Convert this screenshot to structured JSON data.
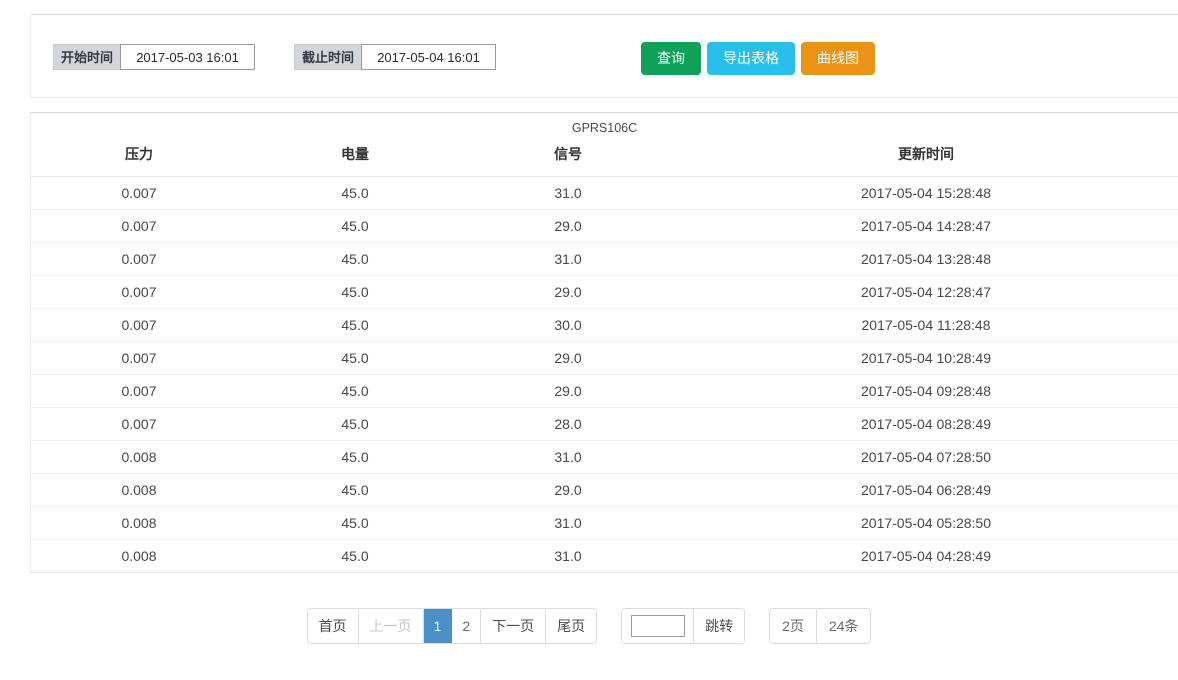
{
  "filters": {
    "start_label": "开始时间",
    "start_value": "2017-05-03 16:01",
    "end_label": "截止时间",
    "end_value": "2017-05-04 16:01",
    "buttons": {
      "query": "查询",
      "export": "导出表格",
      "chart": "曲线图"
    },
    "colors": {
      "query": "#0fa158",
      "export": "#28c0ea",
      "chart": "#eb9316"
    }
  },
  "table": {
    "caption": "GPRS106C",
    "columns": [
      "压力",
      "电量",
      "信号",
      "更新时间"
    ],
    "rows": [
      [
        "0.007",
        "45.0",
        "31.0",
        "2017-05-04 15:28:48"
      ],
      [
        "0.007",
        "45.0",
        "29.0",
        "2017-05-04 14:28:47"
      ],
      [
        "0.007",
        "45.0",
        "31.0",
        "2017-05-04 13:28:48"
      ],
      [
        "0.007",
        "45.0",
        "29.0",
        "2017-05-04 12:28:47"
      ],
      [
        "0.007",
        "45.0",
        "30.0",
        "2017-05-04 11:28:48"
      ],
      [
        "0.007",
        "45.0",
        "29.0",
        "2017-05-04 10:28:49"
      ],
      [
        "0.007",
        "45.0",
        "29.0",
        "2017-05-04 09:28:48"
      ],
      [
        "0.007",
        "45.0",
        "28.0",
        "2017-05-04 08:28:49"
      ],
      [
        "0.008",
        "45.0",
        "31.0",
        "2017-05-04 07:28:50"
      ],
      [
        "0.008",
        "45.0",
        "29.0",
        "2017-05-04 06:28:49"
      ],
      [
        "0.008",
        "45.0",
        "31.0",
        "2017-05-04 05:28:50"
      ],
      [
        "0.008",
        "45.0",
        "31.0",
        "2017-05-04 04:28:49"
      ]
    ]
  },
  "pagination": {
    "first": "首页",
    "prev": "上一页",
    "pages": [
      "1",
      "2"
    ],
    "active_page": "1",
    "next": "下一页",
    "last": "尾页",
    "jump_value": "",
    "jump_label": "跳转",
    "page_count": "2页",
    "record_count": "24条",
    "active_color": "#4a90c6"
  }
}
